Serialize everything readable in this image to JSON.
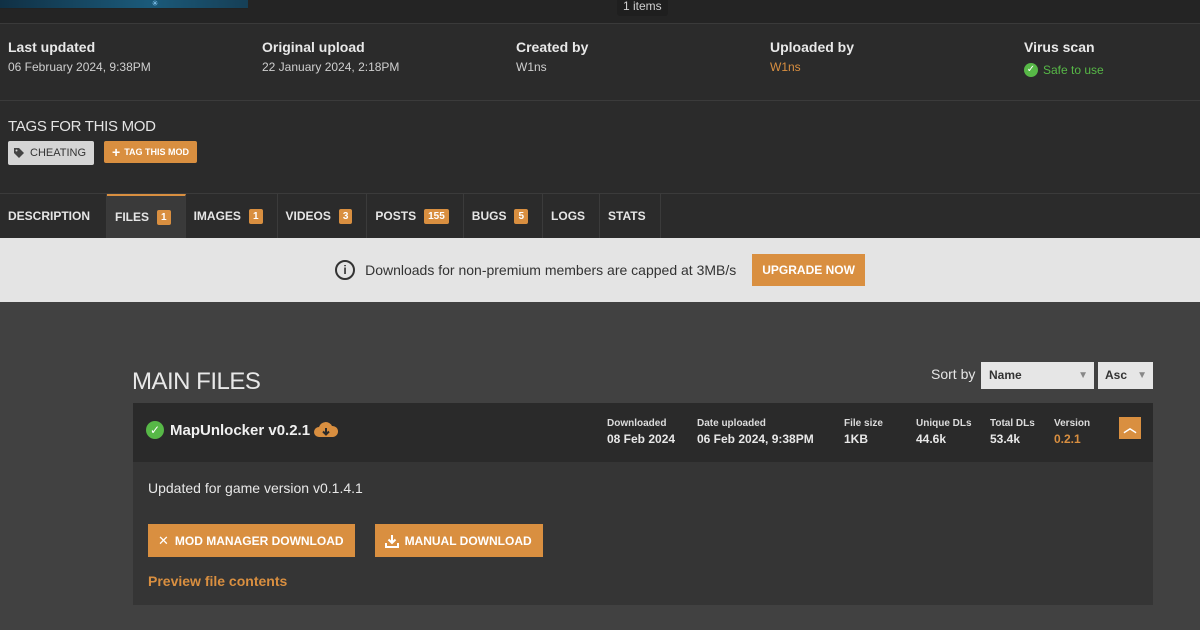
{
  "top": {
    "items_badge": "1 items"
  },
  "meta": {
    "last_updated": {
      "label": "Last updated",
      "value": "06 February 2024,  9:38PM"
    },
    "original_upload": {
      "label": "Original upload",
      "value": "22 January 2024,  2:18PM"
    },
    "created_by": {
      "label": "Created by",
      "value": "W1ns"
    },
    "uploaded_by": {
      "label": "Uploaded by",
      "value": "W1ns"
    },
    "virus_scan": {
      "label": "Virus scan",
      "value": "Safe to use"
    }
  },
  "tags": {
    "title": "TAGS FOR THIS MOD",
    "items": [
      "CHEATING"
    ],
    "tag_button": "TAG THIS MOD"
  },
  "tabs": [
    {
      "label": "DESCRIPTION",
      "count": null
    },
    {
      "label": "FILES",
      "count": "1"
    },
    {
      "label": "IMAGES",
      "count": "1"
    },
    {
      "label": "VIDEOS",
      "count": "3"
    },
    {
      "label": "POSTS",
      "count": "155"
    },
    {
      "label": "BUGS",
      "count": "5"
    },
    {
      "label": "LOGS",
      "count": null
    },
    {
      "label": "STATS",
      "count": null
    }
  ],
  "banner": {
    "text": "Downloads for non-premium members are capped at 3MB/s",
    "button": "UPGRADE NOW"
  },
  "main": {
    "title": "MAIN FILES",
    "sort_label": "Sort by",
    "sort_value": "Name",
    "sort_dir": "Asc"
  },
  "file": {
    "name": "MapUnlocker v0.2.1",
    "stats": {
      "downloaded": {
        "label": "Downloaded",
        "value": "08 Feb 2024"
      },
      "date_uploaded": {
        "label": "Date uploaded",
        "value": "06 Feb 2024, 9:38PM"
      },
      "file_size": {
        "label": "File size",
        "value": "1KB"
      },
      "unique_dls": {
        "label": "Unique DLs",
        "value": "44.6k"
      },
      "total_dls": {
        "label": "Total DLs",
        "value": "53.4k"
      },
      "version": {
        "label": "Version",
        "value": "0.2.1"
      }
    },
    "description": "Updated for game version v0.1.4.1",
    "mod_manager_button": "MOD MANAGER DOWNLOAD",
    "manual_button": "MANUAL DOWNLOAD",
    "preview_link": "Preview file contents"
  },
  "colors": {
    "accent": "#d98f40",
    "safe": "#57b847",
    "background": "#2b2b2b",
    "content_bg": "#414141",
    "banner_bg": "#e4e4e4"
  }
}
